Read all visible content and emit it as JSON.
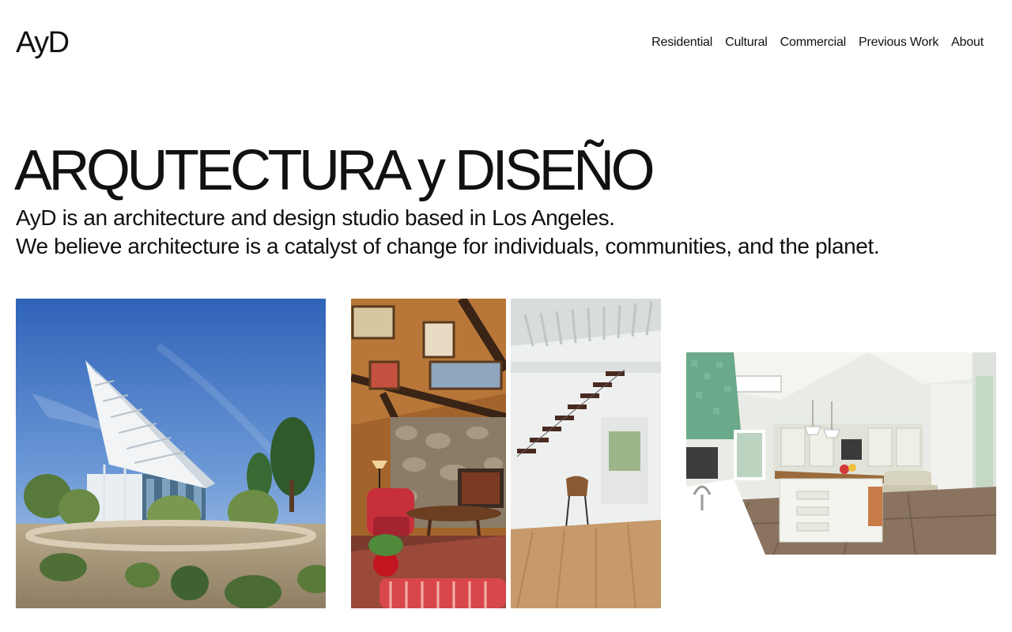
{
  "brand": {
    "logo": "AyD"
  },
  "nav": {
    "items": [
      {
        "label": "Residential"
      },
      {
        "label": "Cultural"
      },
      {
        "label": "Commercial"
      },
      {
        "label": "Previous Work"
      },
      {
        "label": "About"
      }
    ]
  },
  "hero": {
    "title": "ARQUTECTURA y DISEÑO",
    "intro_line_1": "AyD is an architecture and design studio based in Los Angeles.",
    "intro_line_2": "We believe architecture is a catalyst of change for individuals, communities, and the planet."
  },
  "gallery": {
    "images": [
      {
        "subject": "modern building with angled canopy and garden"
      },
      {
        "subject": "interior split view: stone fireplace living room and white staircase"
      },
      {
        "subject": "bright kitchen with island and skylight"
      }
    ]
  }
}
